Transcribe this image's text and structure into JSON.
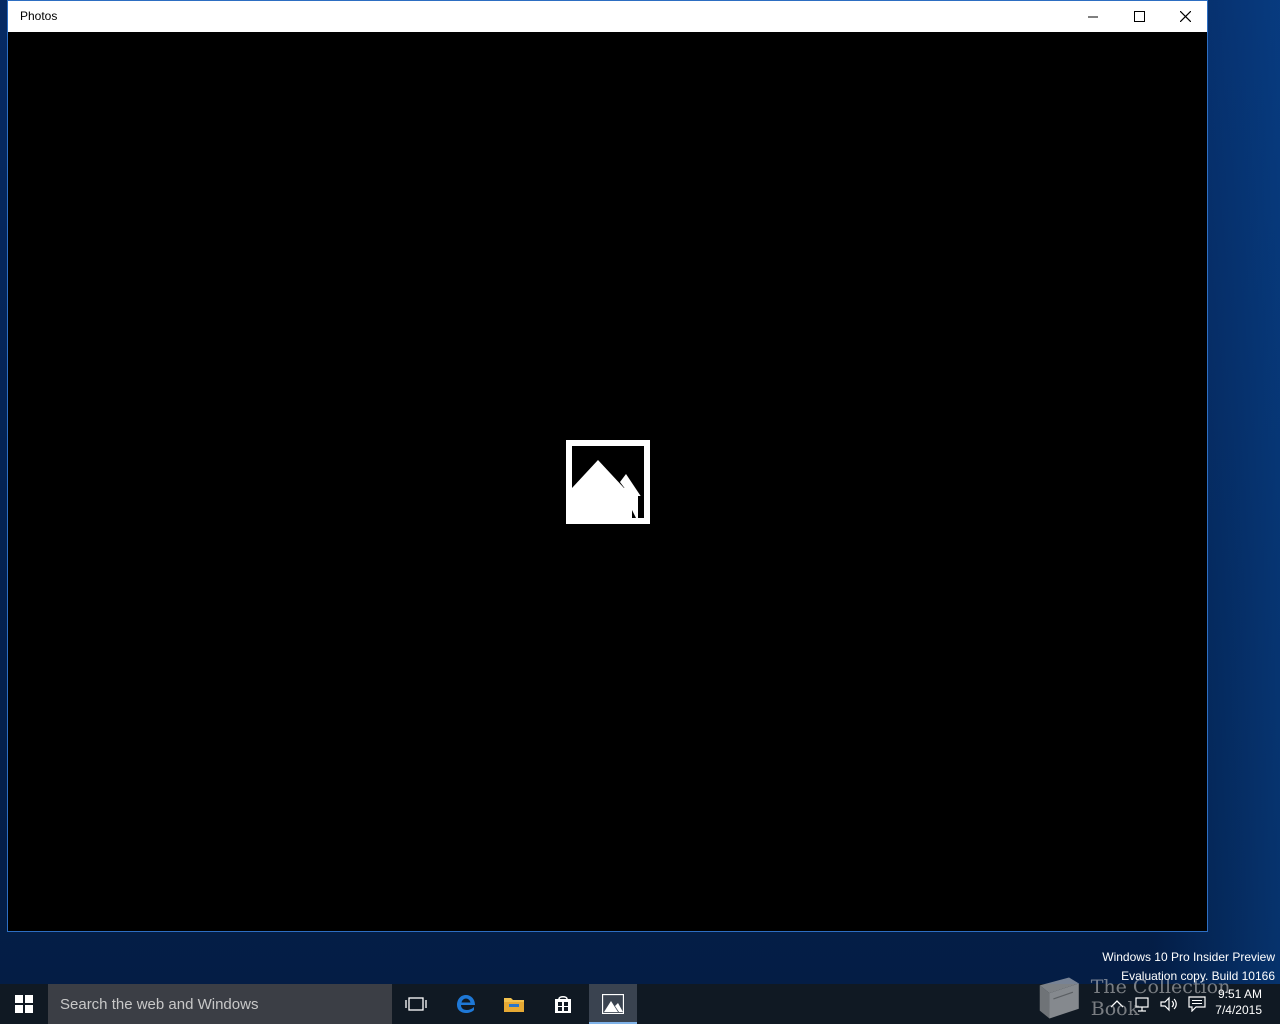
{
  "window": {
    "title": "Photos",
    "controls": {
      "minimize": "minimize-icon",
      "maximize": "maximize-icon",
      "close": "close-icon"
    }
  },
  "content": {
    "center_icon": "photos-app-icon"
  },
  "watermark": {
    "line1": "Windows 10 Pro Insider Preview",
    "line2": "Evaluation copy. Build 10166"
  },
  "overlay_logo": {
    "text": "The Collection Book"
  },
  "taskbar": {
    "search_placeholder": "Search the web and Windows",
    "icons": [
      "windows-start-icon",
      "task-view-icon",
      "edge-icon",
      "file-explorer-icon",
      "store-icon",
      "photos-icon"
    ],
    "active_app": "Photos",
    "clock": {
      "time": "9:51 AM",
      "date": "7/4/2015"
    },
    "tray_icons": [
      "chevron-up-icon",
      "network-icon",
      "volume-icon",
      "action-center-icon"
    ]
  },
  "colors": {
    "window_border": "#2d6ec2",
    "taskbar": "#101923",
    "search_box": "#3b3e45",
    "active_indicator": "#7fb2e8"
  }
}
